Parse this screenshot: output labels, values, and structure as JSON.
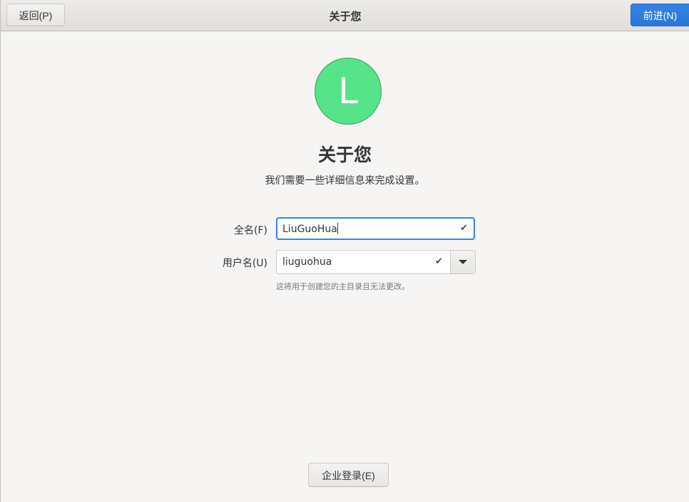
{
  "header": {
    "title": "关于您",
    "back_label": "返回(P)",
    "next_label": "前进(N)"
  },
  "avatar": {
    "letter": "L",
    "color": "#57e389"
  },
  "main": {
    "title": "关于您",
    "subtitle": "我们需要一些详细信息来完成设置。"
  },
  "form": {
    "fullname_label": "全名(F)",
    "fullname_value": "LiuGuoHua",
    "username_label": "用户名(U)",
    "username_value": "liuguohua",
    "username_hint": "这将用于创建您的主目录且无法更改。"
  },
  "footer": {
    "enterprise_label": "企业登录(E)"
  },
  "colors": {
    "accent": "#3584e4",
    "avatar": "#57e389"
  },
  "icons": {
    "valid": "checkmark-icon",
    "dropdown": "chevron-down-icon"
  }
}
